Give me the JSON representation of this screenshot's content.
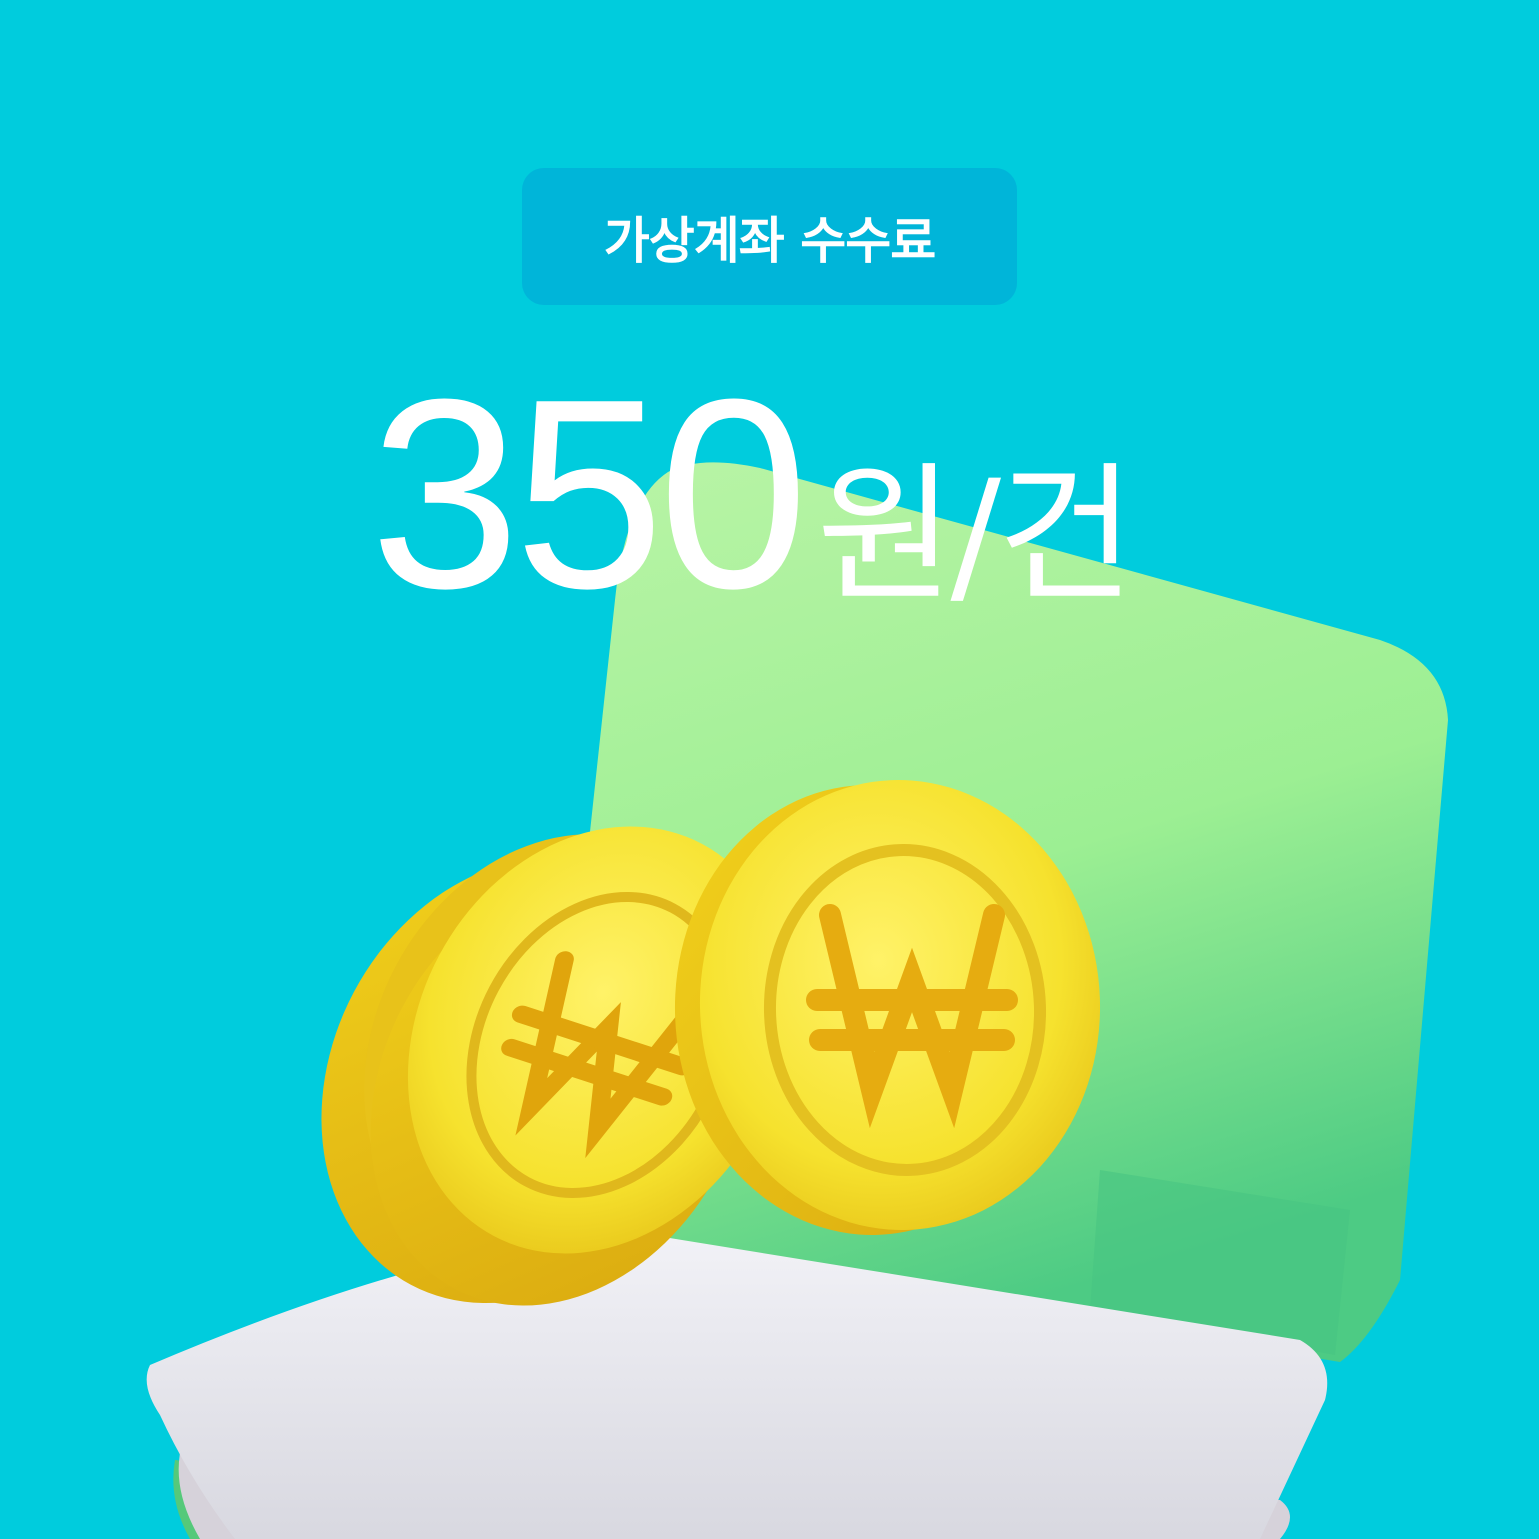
{
  "badge": {
    "label": "가상계좌 수수료"
  },
  "price": {
    "amount": "350",
    "unit": "원/건"
  },
  "colors": {
    "background": "#00CCDD",
    "badge": "#00B5D9",
    "text": "#FFFFFF",
    "coin": "#F7E02A",
    "card": "#9BEF95",
    "paper": "#E4E4EA"
  },
  "illustration": {
    "icons": [
      "won-coin-icon",
      "won-coin-icon",
      "won-coin-icon",
      "bank-book-icon"
    ]
  }
}
